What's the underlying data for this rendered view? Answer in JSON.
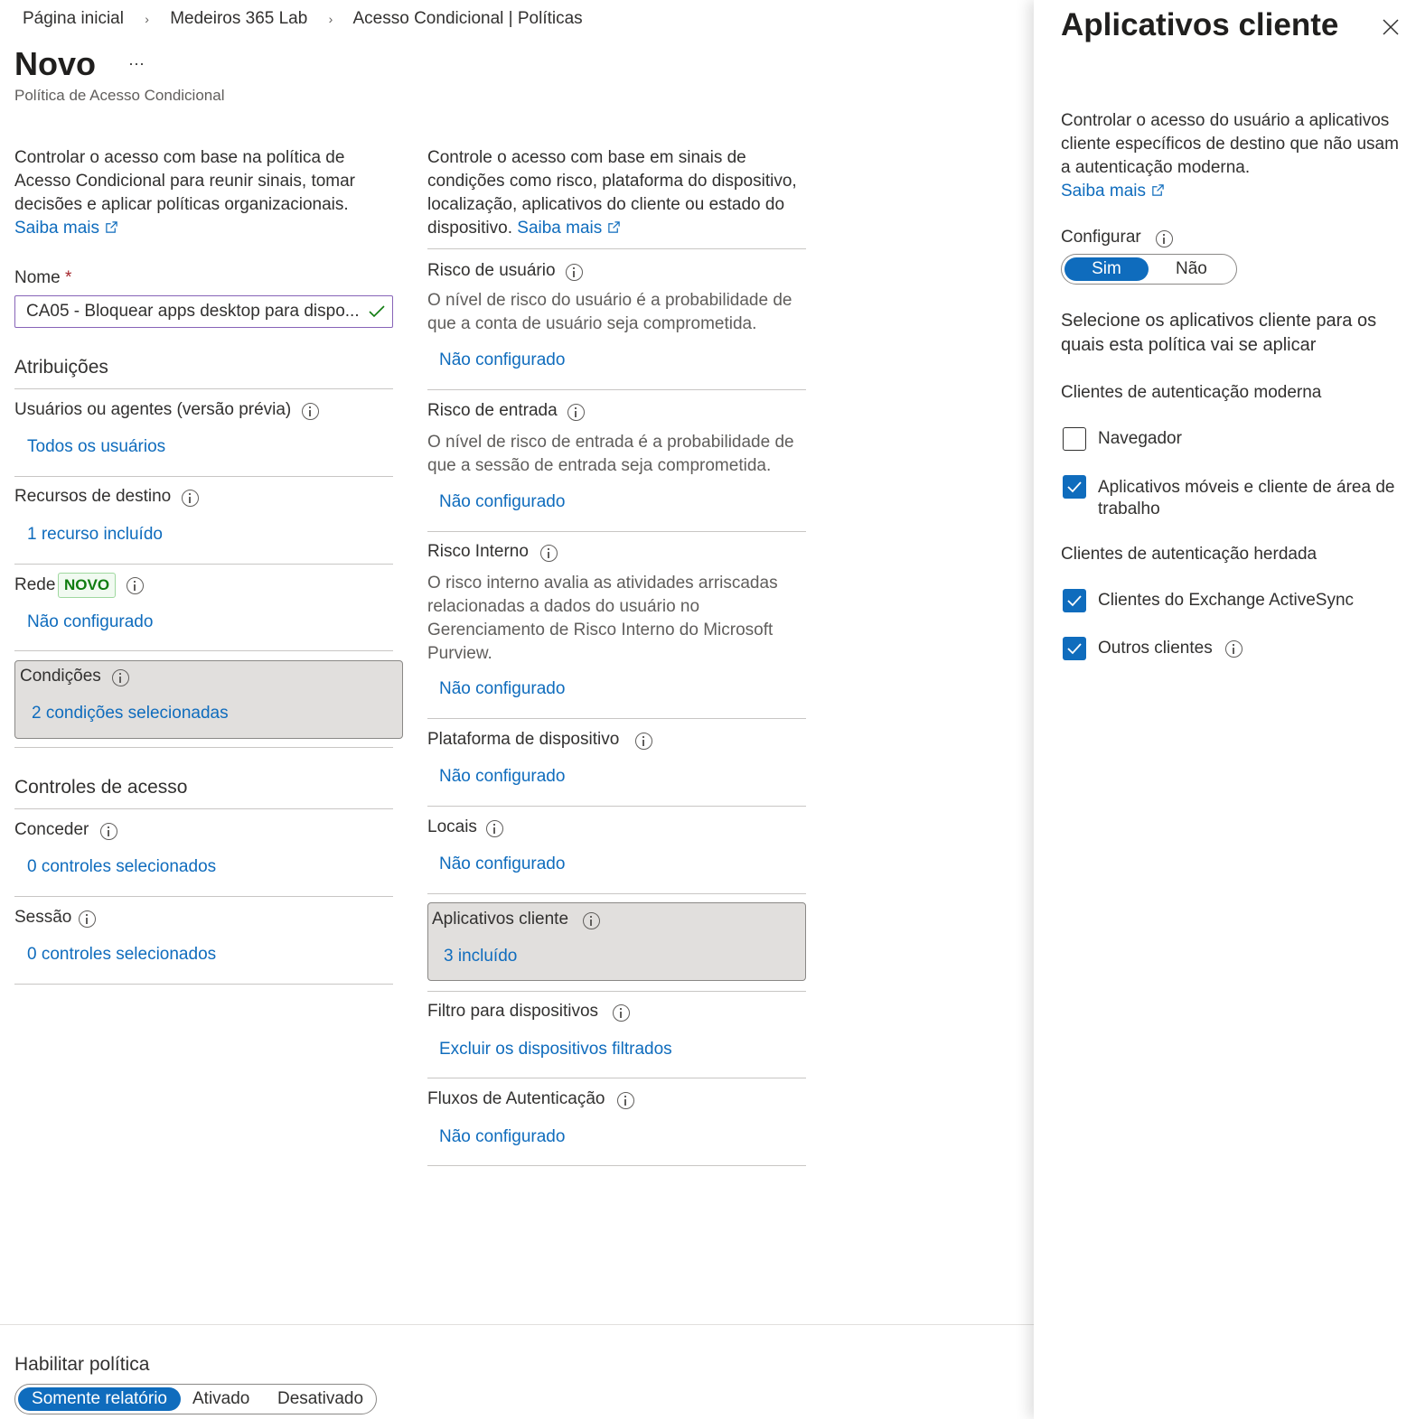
{
  "breadcrumb": [
    "Página inicial",
    "Medeiros 365 Lab",
    "Acesso Condicional | Políticas"
  ],
  "page": {
    "title": "Novo",
    "more": "···",
    "subtitle": "Política de Acesso Condicional"
  },
  "left": {
    "intro": "Controlar o acesso com base na política de Acesso Condicional para reunir sinais, tomar decisões e aplicar políticas organizacionais.",
    "learn_more": "Saiba mais",
    "name_label": "Nome",
    "name_required": "*",
    "name_value": "CA05 - Bloquear apps desktop para dispo...",
    "assignments_heading": "Atribuições",
    "users_label": "Usuários ou agentes (versão prévia)",
    "users_value": "Todos os usuários",
    "resources_label": "Recursos de destino",
    "resources_value": "1 recurso incluído",
    "network_label": "Rede",
    "network_badge": "NOVO",
    "network_value": "Não configurado",
    "conditions_label": "Condições",
    "conditions_value": "2 condições selecionadas",
    "access_heading": "Controles de acesso",
    "grant_label": "Conceder",
    "grant_value": "0 controles selecionados",
    "session_label": "Sessão",
    "session_value": "0 controles selecionados"
  },
  "middle": {
    "intro": "Controle o acesso com base em sinais de condições como risco, plataforma do dispositivo, localização, aplicativos do cliente ou estado do dispositivo.",
    "learn_more": "Saiba mais",
    "user_risk_label": "Risco de usuário",
    "user_risk_desc": "O nível de risco do usuário é a probabilidade de que a conta de usuário seja comprometida.",
    "user_risk_value": "Não configurado",
    "signin_risk_label": "Risco de entrada",
    "signin_risk_desc": "O nível de risco de entrada é a probabilidade de que a sessão de entrada seja comprometida.",
    "signin_risk_value": "Não configurado",
    "insider_risk_label": "Risco Interno",
    "insider_risk_desc": "O risco interno avalia as atividades arriscadas relacionadas a dados do usuário no Gerenciamento de Risco Interno do Microsoft Purview.",
    "insider_risk_value": "Não configurado",
    "platform_label": "Plataforma de dispositivo",
    "platform_value": "Não configurado",
    "locations_label": "Locais",
    "locations_value": "Não configurado",
    "client_apps_label": "Aplicativos cliente",
    "client_apps_value": "3 incluído",
    "filter_label": "Filtro para dispositivos",
    "filter_value": "Excluir os dispositivos filtrados",
    "auth_flows_label": "Fluxos de Autenticação",
    "auth_flows_value": "Não configurado"
  },
  "footer": {
    "enable_label": "Habilitar política",
    "options": [
      "Somente relatório",
      "Ativado",
      "Desativado"
    ],
    "selected": "Somente relatório"
  },
  "panel": {
    "title": "Aplicativos cliente",
    "desc": "Controlar o acesso do usuário a aplicativos cliente específicos de destino que não usam a autenticação moderna.",
    "learn_more": "Saiba mais",
    "configure_label": "Configurar",
    "toggle_yes": "Sim",
    "toggle_no": "Não",
    "toggle_selected": "Sim",
    "select_text": "Selecione os aplicativos cliente para os quais esta política vai se aplicar",
    "modern_heading": "Clientes de autenticação moderna",
    "browser_label": "Navegador",
    "browser_checked": false,
    "mobile_label": "Aplicativos móveis e cliente de área de trabalho",
    "mobile_checked": true,
    "legacy_heading": "Clientes de autenticação herdada",
    "eas_label": "Clientes do Exchange ActiveSync",
    "eas_checked": true,
    "other_label": "Outros clientes",
    "other_checked": true
  },
  "colors": {
    "accent": "#0f6cbd",
    "badge_green": "#107c10",
    "badge_bg": "#f1faf1",
    "input_border": "#8764b8",
    "selected_bg": "#e1dfdd"
  }
}
